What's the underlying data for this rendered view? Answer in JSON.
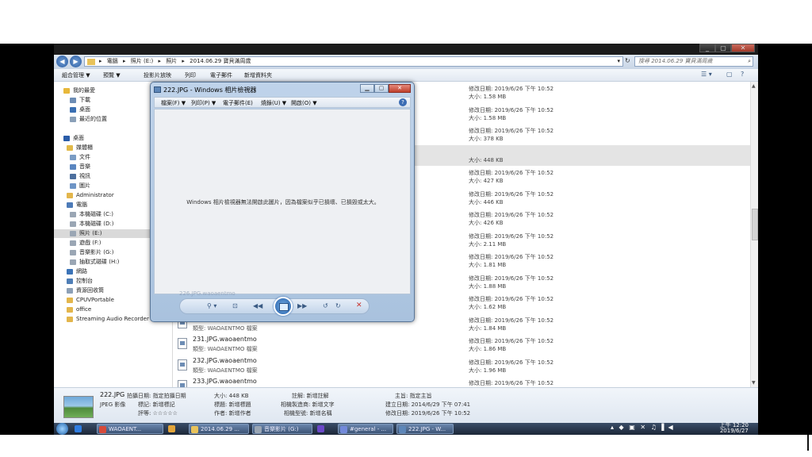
{
  "explorer": {
    "window_buttons": {
      "minimize": "_",
      "maximize": "▢",
      "close": "✕"
    },
    "address": {
      "segments": [
        "▸",
        "電腦",
        "▸",
        "照片 (E:)",
        "▸",
        "照片",
        "▸",
        "2014.06.29 寶貝滿周歲"
      ],
      "dropdown": "▾",
      "refresh": "↻"
    },
    "search": {
      "placeholder": "搜尋 2014.06.29 寶貝滿周歲",
      "icon": "⌕"
    },
    "toolbar": {
      "organize": "組合管理 ▼",
      "preview": "預覽 ▼",
      "slideshow": "投影片放映",
      "print": "列印",
      "email": "電子郵件",
      "new_folder": "新增資料夾",
      "view_icon": "☰ ▾",
      "pane_icon": "▢",
      "help_icon": "?"
    },
    "nav": [
      {
        "label": "我的最愛",
        "color": "#e8b83a"
      },
      {
        "label": "下載",
        "color": "#6d8db5"
      },
      {
        "label": "桌面",
        "color": "#3a6fb3"
      },
      {
        "label": "最近的位置",
        "color": "#8aa0b8"
      },
      {
        "label": "桌面",
        "color": "#2a5ca8"
      },
      {
        "label": "媒體櫃",
        "color": "#e1b94a"
      },
      {
        "label": "文件",
        "color": "#7a9cc4"
      },
      {
        "label": "音樂",
        "color": "#5a86c0"
      },
      {
        "label": "視訊",
        "color": "#4c6f9e"
      },
      {
        "label": "圖片",
        "color": "#6e95c6"
      },
      {
        "label": "Administrator",
        "color": "#e3b64c"
      },
      {
        "label": "電腦",
        "color": "#4d7bb8"
      },
      {
        "label": "本機磁碟 (C:)",
        "color": "#9aa6b4"
      },
      {
        "label": "本機磁碟 (D:)",
        "color": "#9aa6b4"
      },
      {
        "label": "照片 (E:)",
        "color": "#9aa6b4"
      },
      {
        "label": "遊戲 (F:)",
        "color": "#9aa6b4"
      },
      {
        "label": "音樂影片 (G:)",
        "color": "#9aa6b4"
      },
      {
        "label": "抽取式磁碟 (H:)",
        "color": "#9aa6b4"
      },
      {
        "label": "網路",
        "color": "#3c74b8"
      },
      {
        "label": "控制台",
        "color": "#4f7eb6"
      },
      {
        "label": "資源回收筒",
        "color": "#8da0b6"
      },
      {
        "label": "CPUVPortable",
        "color": "#e3b64c"
      },
      {
        "label": "office",
        "color": "#e3b64c"
      },
      {
        "label": "Streaming Audio Recorder",
        "color": "#e3b64c"
      }
    ],
    "files": [
      {
        "name": "",
        "type": "",
        "modified": "修改日期: 2019/6/26 下午 10:52",
        "size": "大小: 1.58 MB"
      },
      {
        "name": "",
        "type": "",
        "modified": "修改日期: 2019/6/26 下午 10:52",
        "size": "大小: 1.58 MB"
      },
      {
        "name": "",
        "type": "",
        "modified": "修改日期: 2019/6/26 下午 10:52",
        "size": "大小: 378 KB"
      },
      {
        "name": "",
        "type": "",
        "modified": "",
        "size": "大小: 448 KB"
      },
      {
        "name": "",
        "type": "",
        "modified": "修改日期: 2019/6/26 下午 10:52",
        "size": "大小: 427 KB"
      },
      {
        "name": "",
        "type": "",
        "modified": "修改日期: 2019/6/26 下午 10:52",
        "size": "大小: 446 KB"
      },
      {
        "name": "",
        "type": "",
        "modified": "修改日期: 2019/6/26 下午 10:52",
        "size": "大小: 426 KB"
      },
      {
        "name": "",
        "type": "",
        "modified": "修改日期: 2019/6/26 下午 10:52",
        "size": "大小: 2.11 MB"
      },
      {
        "name": "",
        "type": "",
        "modified": "修改日期: 2019/6/26 下午 10:52",
        "size": "大小: 1.81 MB"
      },
      {
        "name": "",
        "type": "",
        "modified": "修改日期: 2019/6/26 下午 10:52",
        "size": "大小: 1.88 MB"
      },
      {
        "name": "",
        "type": "",
        "modified": "修改日期: 2019/6/26 下午 10:52",
        "size": "大小: 1.62 MB"
      },
      {
        "name": "",
        "type": "類型: WAOAENTMO 檔案",
        "modified": "修改日期: 2019/6/26 下午 10:52",
        "size": "大小: 1.84 MB"
      },
      {
        "name": "231.JPG.waoaentmo",
        "type": "類型: WAOAENTMO 檔案",
        "modified": "修改日期: 2019/6/26 下午 10:52",
        "size": "大小: 1.86 MB"
      },
      {
        "name": "232.JPG.waoaentmo",
        "type": "類型: WAOAENTMO 檔案",
        "modified": "修改日期: 2019/6/26 下午 10:52",
        "size": "大小: 1.96 MB"
      },
      {
        "name": "233.JPG.waoaentmo",
        "type": "",
        "modified": "修改日期: 2019/6/26 下午 10:52",
        "size": ""
      }
    ],
    "details": {
      "filename": "222.JPG",
      "filetype": "JPEG 影像",
      "date_taken": "拍攝日期: 指定拍攝日期",
      "tags": "標記: 新增標記",
      "rating": "評等: ☆☆☆☆☆",
      "size": "大小: 448 KB",
      "title": "標題: 新增標題",
      "authors": "作者: 新增作者",
      "comments": "註解: 新增註解",
      "camera_maker": "相機製造商: 新增文字",
      "camera_model": "相機型號: 新增名稱",
      "subject": "主旨: 指定主旨",
      "created": "建立日期: 2014/6/29 下午 07:41",
      "modified": "修改日期: 2019/6/26 下午 10:52"
    }
  },
  "viewer": {
    "title": "222.JPG - Windows 相片檢視器",
    "buttons": {
      "minimize": "▁",
      "maximize": "▢",
      "close": "✕"
    },
    "menu": [
      "檔案(F) ▼",
      "列印(P) ▼",
      "電子郵件(E)",
      "燒錄(U) ▼",
      "開啟(O) ▼"
    ],
    "help": "?",
    "message": "Windows 相片檢視器無法開啟此圖片，因為檔案似乎已損壞、已損毀或太大。",
    "controls": {
      "zoom": "⚲ ▾",
      "fit": "⊡",
      "prev": "◀◀",
      "next": "▶▶",
      "rotate_ccw": "↺",
      "rotate_cw": "↻",
      "delete": "✕"
    },
    "ghost_text": "226.JPG.waoaentmo"
  },
  "taskbar": {
    "items": [
      {
        "label": "",
        "color": "#2f7de1"
      },
      {
        "label": "WAOAENT...",
        "color": "#d64a3a"
      },
      {
        "label": "",
        "color": "#e2a43a"
      },
      {
        "label": "2014.06.29 ...",
        "color": "#e8c25a"
      },
      {
        "label": "音樂影片 (G:)",
        "color": "#9aa6b4"
      },
      {
        "label": "",
        "color": "#6b48c8"
      },
      {
        "label": "#general - ...",
        "color": "#7289da"
      },
      {
        "label": "222.JPG - W...",
        "color": "#5d86b8"
      }
    ],
    "tray": "▴ ◆ ▣ ✕ ♫ ▌◀",
    "time": "上午 12:20",
    "date": "2019/6/27"
  }
}
